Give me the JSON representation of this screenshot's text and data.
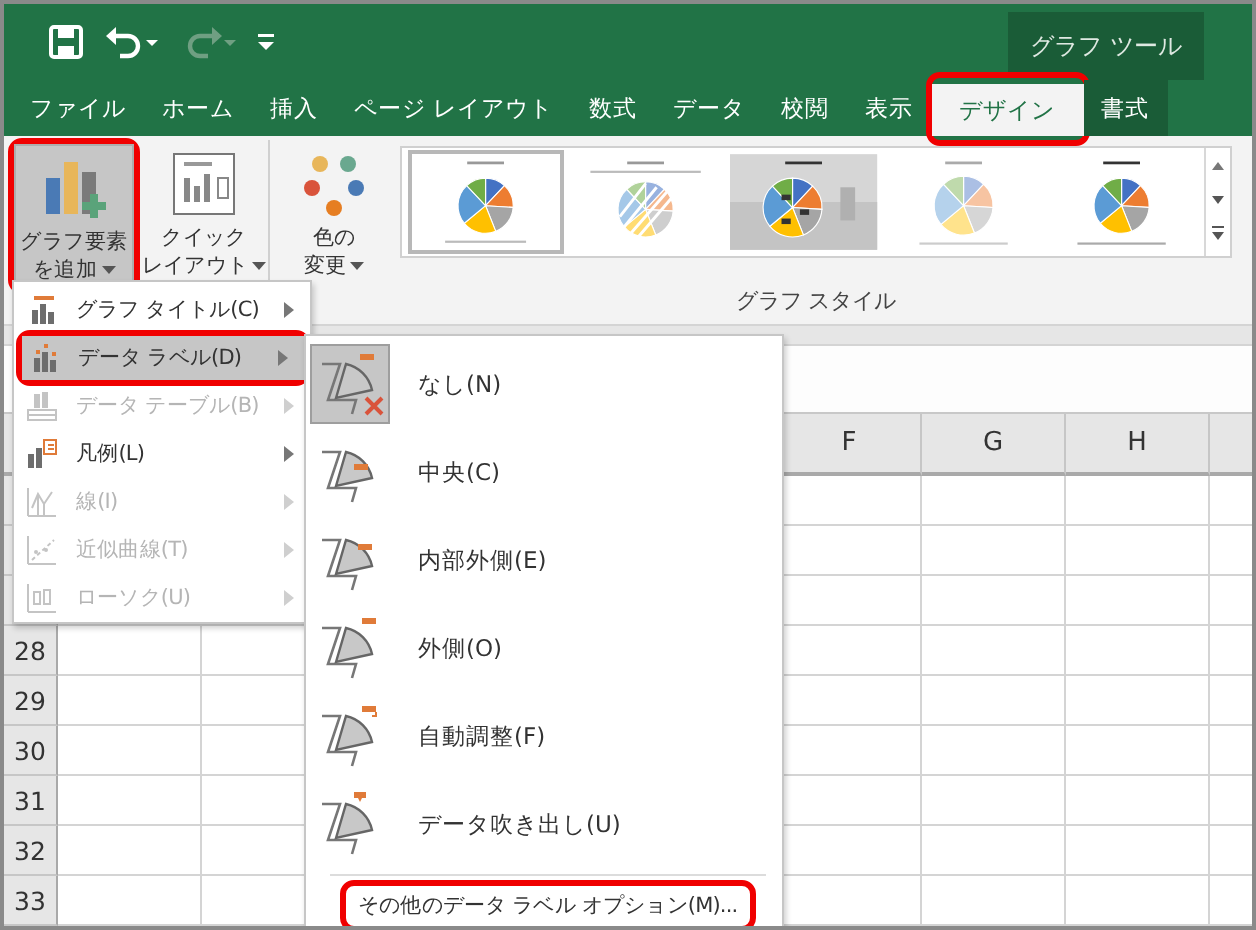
{
  "title_bar": {
    "context_tab": "グラフ ツール"
  },
  "ribbon_tabs": [
    {
      "label": "ファイル",
      "selected": false,
      "highlighted": false
    },
    {
      "label": "ホーム",
      "selected": false,
      "highlighted": false
    },
    {
      "label": "挿入",
      "selected": false,
      "highlighted": false
    },
    {
      "label": "ページ レイアウト",
      "selected": false,
      "highlighted": false
    },
    {
      "label": "数式",
      "selected": false,
      "highlighted": false
    },
    {
      "label": "データ",
      "selected": false,
      "highlighted": false
    },
    {
      "label": "校閲",
      "selected": false,
      "highlighted": false
    },
    {
      "label": "表示",
      "selected": false,
      "highlighted": false
    },
    {
      "label": "デザイン",
      "selected": true,
      "highlighted": true
    },
    {
      "label": "書式",
      "selected": false,
      "highlighted": false
    }
  ],
  "ribbon": {
    "buttons": [
      {
        "kind": "add_element",
        "lines": [
          "グラフ要素",
          "を追加"
        ],
        "pressed": true,
        "highlighted": true
      },
      {
        "kind": "quick_layout",
        "lines": [
          "クイック",
          "レイアウト"
        ],
        "pressed": false,
        "highlighted": false
      },
      {
        "kind": "colors",
        "lines": [
          "色の",
          "変更"
        ],
        "pressed": false,
        "highlighted": false
      }
    ],
    "gallery": [
      {
        "kind": "plain",
        "selected": true
      },
      {
        "kind": "striped",
        "selected": false
      },
      {
        "kind": "shaded",
        "selected": false
      },
      {
        "kind": "pastel",
        "selected": false
      },
      {
        "kind": "legend",
        "selected": false
      }
    ],
    "group_label": "グラフ スタイル"
  },
  "sheet": {
    "columns": [
      "F",
      "G",
      "H"
    ],
    "rows": [
      "28",
      "29",
      "30",
      "31",
      "32",
      "33"
    ]
  },
  "element_menu": {
    "items": [
      {
        "kind": "title",
        "label": "グラフ タイトル(C)",
        "disabled": false,
        "selected": false,
        "highlighted": false
      },
      {
        "kind": "data_labels",
        "label": "データ ラベル(D)",
        "disabled": false,
        "selected": true,
        "highlighted": true
      },
      {
        "kind": "data_table",
        "label": "データ テーブル(B)",
        "disabled": true,
        "selected": false,
        "highlighted": false
      },
      {
        "kind": "legend",
        "label": "凡例(L)",
        "disabled": false,
        "selected": false,
        "highlighted": false
      },
      {
        "kind": "lines",
        "label": "線(I)",
        "disabled": true,
        "selected": false,
        "highlighted": false
      },
      {
        "kind": "trendline",
        "label": "近似曲線(T)",
        "disabled": true,
        "selected": false,
        "highlighted": false
      },
      {
        "kind": "updown",
        "label": "ローソク(U)",
        "disabled": true,
        "selected": false,
        "highlighted": false
      }
    ]
  },
  "data_label_menu": {
    "items": [
      {
        "kind": "none",
        "label": "なし(N)",
        "selected": true
      },
      {
        "kind": "center",
        "label": "中央(C)",
        "selected": false
      },
      {
        "kind": "inside_end",
        "label": "内部外側(E)",
        "selected": false
      },
      {
        "kind": "outside_end",
        "label": "外側(O)",
        "selected": false
      },
      {
        "kind": "best_fit",
        "label": "自動調整(F)",
        "selected": false
      },
      {
        "kind": "callout",
        "label": "データ吹き出し(U)",
        "selected": false
      }
    ],
    "more_options": {
      "label": "その他のデータ ラベル オプション(M)...",
      "highlighted": true
    }
  }
}
